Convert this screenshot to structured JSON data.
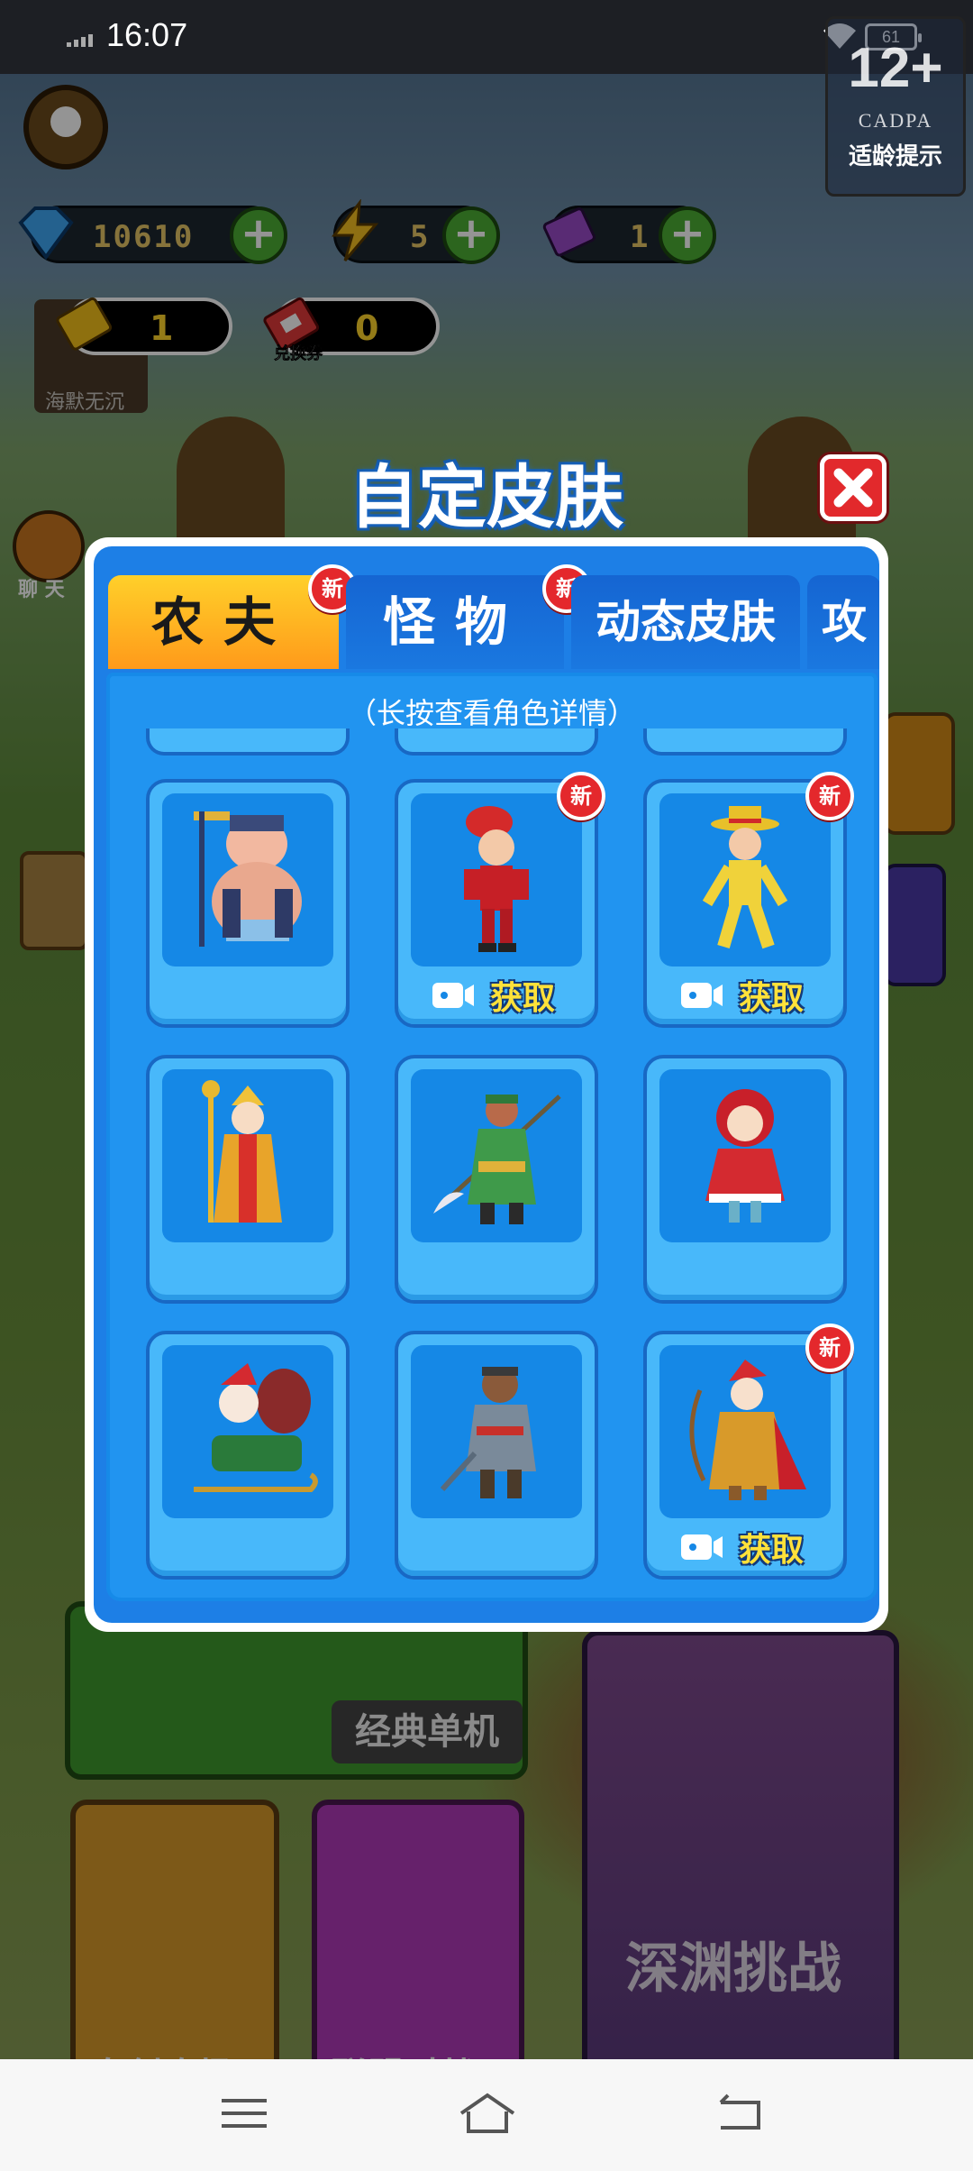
{
  "status_bar": {
    "time": "16:07",
    "battery": "61"
  },
  "age_rating": {
    "number": "12+",
    "org": "CADPA",
    "tip": "适龄提示"
  },
  "resources": [
    {
      "name": "diamond",
      "value": "10610",
      "icon": "diamond-icon",
      "color": "#3fa7f5"
    },
    {
      "name": "energy",
      "value": "5",
      "icon": "lightning-icon",
      "color": "#f5c021"
    },
    {
      "name": "ticket",
      "value": "1",
      "icon": "purple-ticket-icon",
      "color": "#9a4bc8"
    }
  ],
  "vouchers": [
    {
      "value": "1",
      "icon": "gold-ticket-icon"
    },
    {
      "value": "0",
      "icon": "exchange-ticket-icon",
      "label": "兑换券"
    }
  ],
  "player": {
    "name": "海默无沉"
  },
  "side": {
    "chat": "聊 天"
  },
  "dialog": {
    "title": "自定皮肤",
    "hint": "（长按查看角色详情）",
    "tabs": [
      {
        "label": "农夫",
        "new": "新",
        "active": true
      },
      {
        "label": "怪物",
        "new": "新"
      },
      {
        "label": "动态皮肤"
      },
      {
        "label": "攻"
      }
    ],
    "skins": [
      {
        "name": "pig-general",
        "action": ""
      },
      {
        "name": "red-hair-warrior",
        "action": "获取",
        "new": "新"
      },
      {
        "name": "yellow-suit-dancer",
        "action": "获取",
        "new": "新"
      },
      {
        "name": "golden-monk",
        "action": ""
      },
      {
        "name": "green-general",
        "action": ""
      },
      {
        "name": "red-hood-girl",
        "action": ""
      },
      {
        "name": "santa-sleigh",
        "action": ""
      },
      {
        "name": "armored-general",
        "action": ""
      },
      {
        "name": "golden-archer",
        "action": "获取",
        "new": "新"
      }
    ]
  },
  "menu": {
    "classic": "经典单机",
    "create": "自创农场",
    "versus": "联盟对战",
    "abyss": "深渊挑战"
  }
}
